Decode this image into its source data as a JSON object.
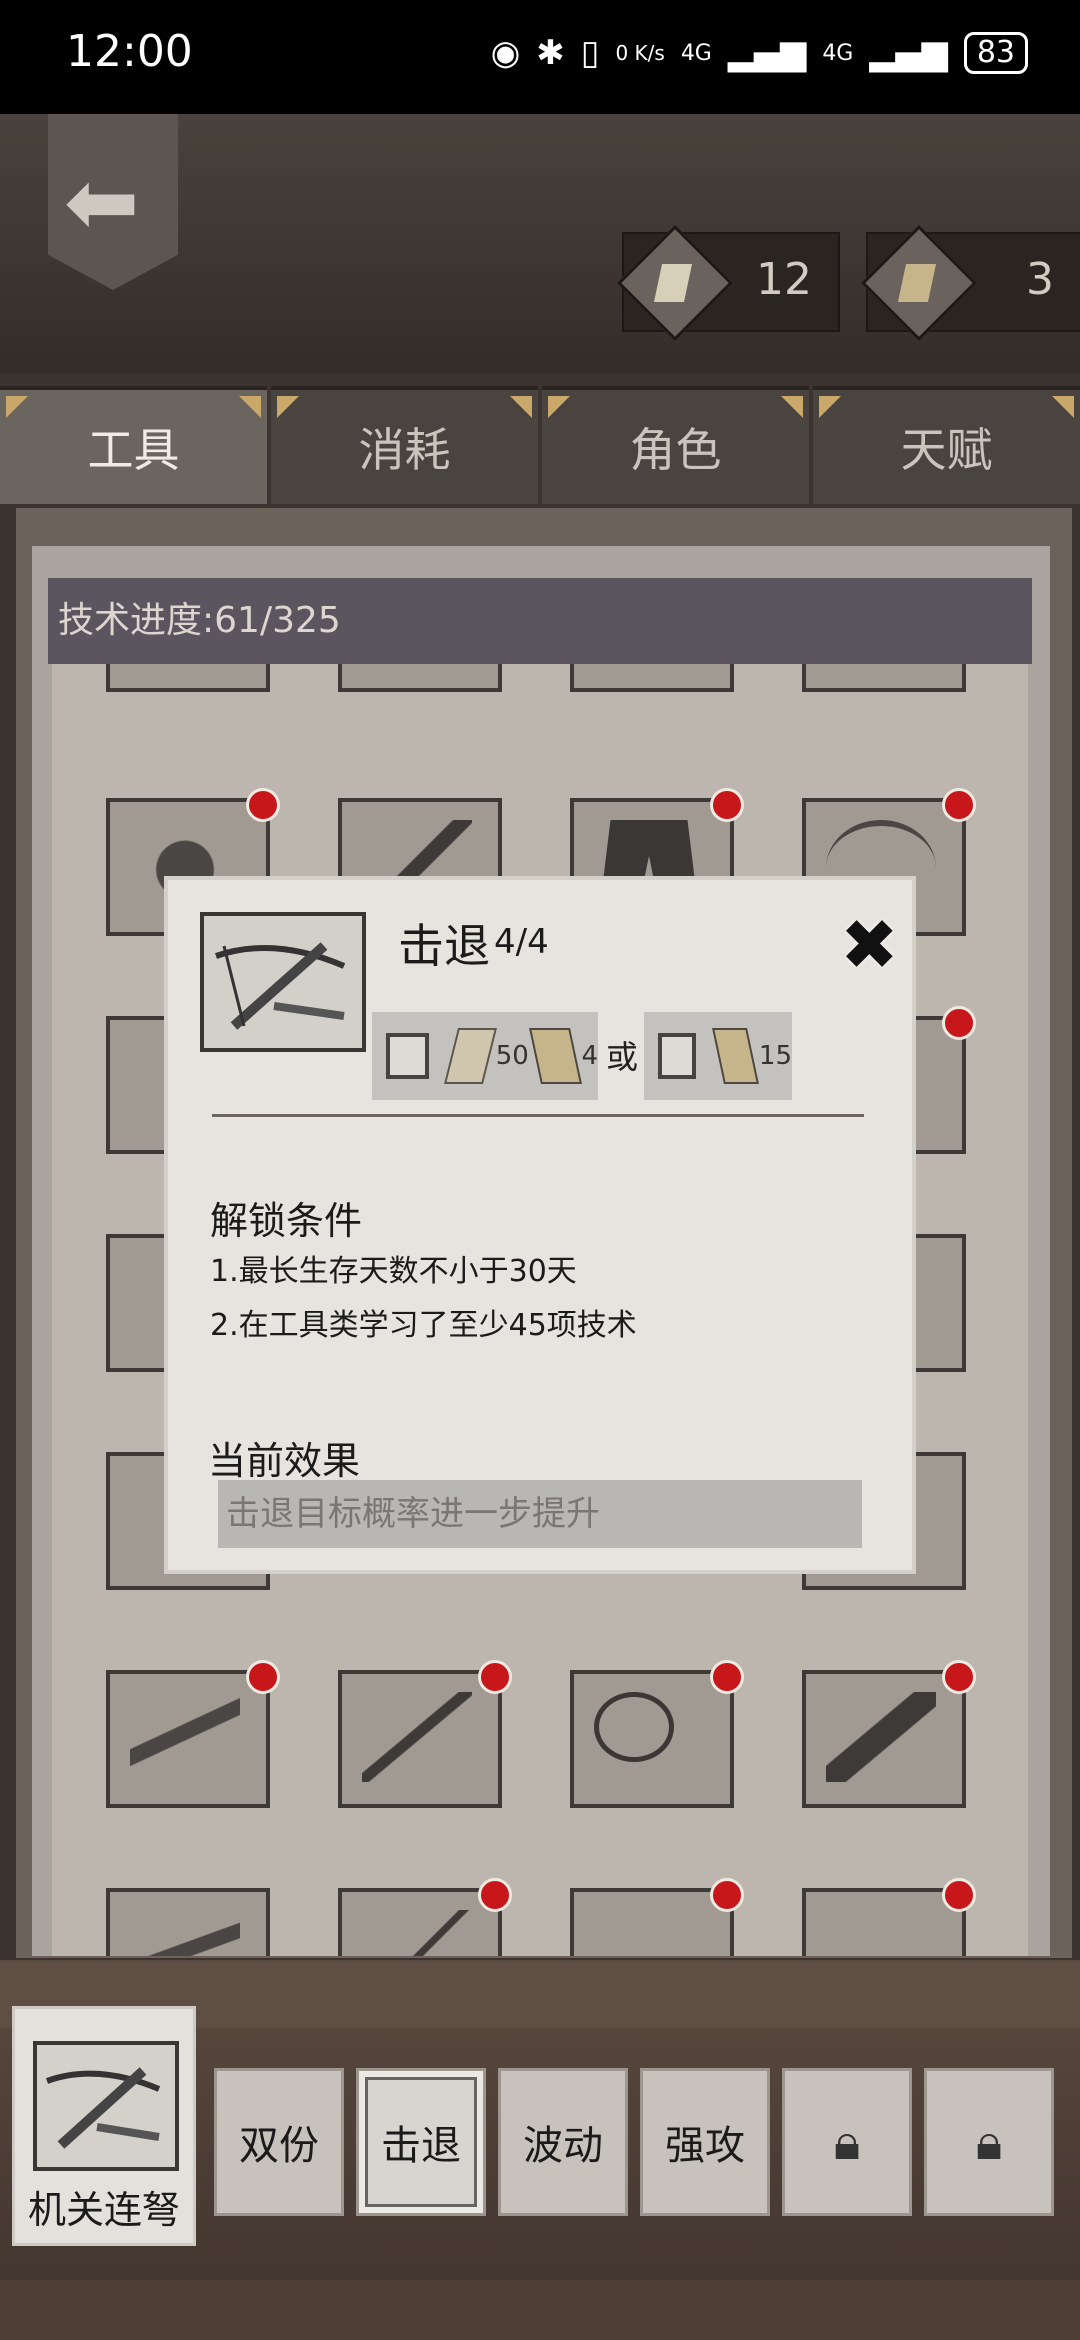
{
  "status_bar": {
    "time": "12:00",
    "net_speed": "0 K/s",
    "signal1": "4G",
    "signal2": "4G",
    "battery": "83"
  },
  "header": {
    "resources": [
      {
        "name": "scroll",
        "icon": "scroll-icon",
        "value": "12"
      },
      {
        "name": "book",
        "icon": "book-icon",
        "value": "3"
      }
    ]
  },
  "tabs": [
    {
      "label": "工具",
      "active": true
    },
    {
      "label": "消耗",
      "active": false
    },
    {
      "label": "角色",
      "active": false
    },
    {
      "label": "天赋",
      "active": false
    }
  ],
  "progress": {
    "label": "技术进度:61/325",
    "current": 61,
    "total": 325
  },
  "grid_rows": [
    [
      "bomb-icon",
      "axe-icon",
      "pants-icon",
      "bow-icon"
    ],
    [
      "club-icon",
      "",
      "",
      "spear-icon"
    ],
    [
      "staff-icon",
      "",
      "",
      "stick-icon"
    ],
    [
      "blade-icon",
      "",
      "",
      "hammer-icon"
    ],
    [
      "crossbow-icon",
      "bow-icon",
      "whip-icon",
      "sword-icon"
    ],
    [
      "crossbow-icon",
      "spear-icon",
      "gun-icon",
      "club-icon"
    ]
  ],
  "popup": {
    "title": "击退",
    "level": "4/4",
    "cost_a_scroll": "50",
    "cost_a_book": "4",
    "or_label": "或",
    "cost_b_book": "15",
    "unlock_heading": "解锁条件",
    "conditions": [
      "1.最长生存天数不小于30天",
      "2.在工具类学习了至少45项技术"
    ],
    "effect_heading": "当前效果",
    "effect_text": "击退目标概率进一步提升"
  },
  "bottom": {
    "tool_name": "机关连弩",
    "skills": [
      {
        "label": "双份",
        "locked": false,
        "active": false
      },
      {
        "label": "击退",
        "locked": false,
        "active": true
      },
      {
        "label": "波动",
        "locked": false,
        "active": false
      },
      {
        "label": "强攻",
        "locked": false,
        "active": false
      },
      {
        "label": "",
        "locked": true,
        "active": false
      },
      {
        "label": "",
        "locked": true,
        "active": false
      }
    ]
  },
  "colors": {
    "red_dot": "#c8171b",
    "parchment": "#bcb6ae",
    "tab_active": "#6b6560"
  }
}
